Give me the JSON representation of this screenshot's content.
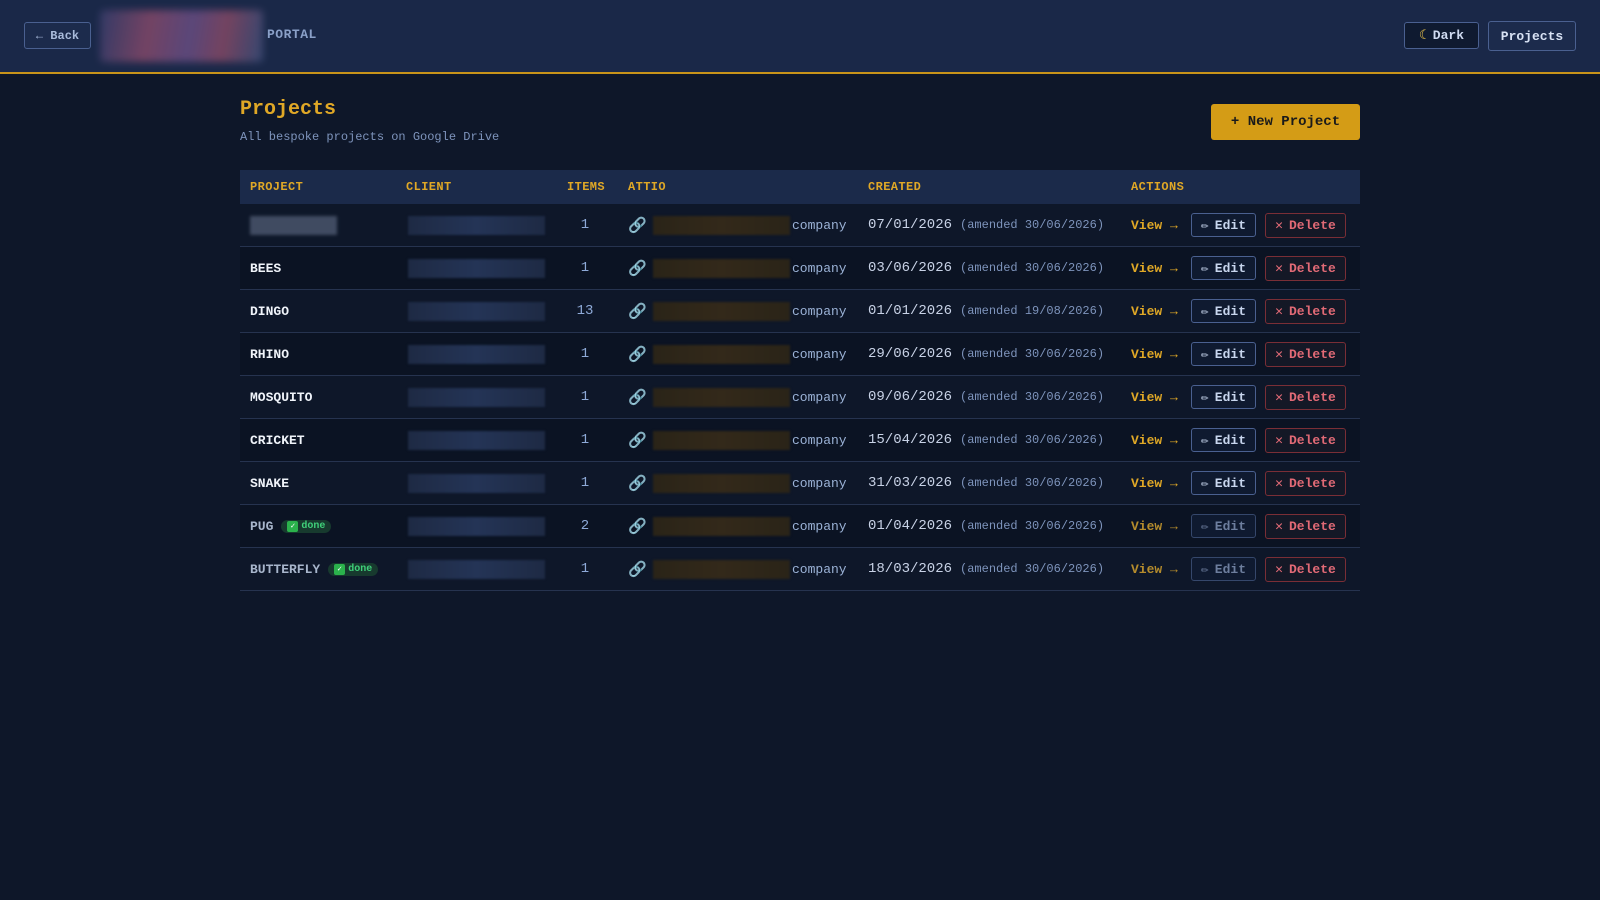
{
  "header": {
    "back_label": "← Back",
    "portal_label": "PORTAL",
    "theme_label": "Dark",
    "theme_icon": "moon-icon",
    "projects_label": "Projects"
  },
  "page": {
    "title": "Projects",
    "subtitle": "All bespoke projects on Google Drive",
    "new_project_label": "+ New Project"
  },
  "table": {
    "columns": [
      "PROJECT",
      "CLIENT",
      "ITEMS",
      "ATTIO",
      "CREATED",
      "ACTIONS"
    ],
    "rows": [
      {
        "name": "",
        "name_hidden": true,
        "items": "1",
        "attio_type": "company",
        "created": "07/01/2026",
        "amended": "(amended 30/06/2026)",
        "done": false
      },
      {
        "name": "BEES",
        "items": "1",
        "attio_type": "company",
        "created": "03/06/2026",
        "amended": "(amended 30/06/2026)",
        "done": false
      },
      {
        "name": "DINGO",
        "items": "13",
        "attio_type": "company",
        "created": "01/01/2026",
        "amended": "(amended 19/08/2026)",
        "done": false
      },
      {
        "name": "RHINO",
        "items": "1",
        "attio_type": "company",
        "created": "29/06/2026",
        "amended": "(amended 30/06/2026)",
        "done": false
      },
      {
        "name": "MOSQUITO",
        "items": "1",
        "attio_type": "company",
        "created": "09/06/2026",
        "amended": "(amended 30/06/2026)",
        "done": false
      },
      {
        "name": "CRICKET",
        "items": "1",
        "attio_type": "company",
        "created": "15/04/2026",
        "amended": "(amended 30/06/2026)",
        "done": false
      },
      {
        "name": "SNAKE",
        "items": "1",
        "attio_type": "company",
        "created": "31/03/2026",
        "amended": "(amended 30/06/2026)",
        "done": false
      },
      {
        "name": "PUG",
        "items": "2",
        "attio_type": "company",
        "created": "01/04/2026",
        "amended": "(amended 30/06/2026)",
        "done": true
      },
      {
        "name": "BUTTERFLY",
        "items": "1",
        "attio_type": "company",
        "created": "18/03/2026",
        "amended": "(amended 30/06/2026)",
        "done": true
      }
    ],
    "done_label": "done",
    "view_label": "View →",
    "edit_label": "Edit",
    "delete_label": "Delete"
  },
  "colors": {
    "accent": "#e0a826",
    "background": "#0e1729",
    "header_bg": "#1a2848",
    "danger": "#e26a76",
    "done": "#3fd07a"
  }
}
